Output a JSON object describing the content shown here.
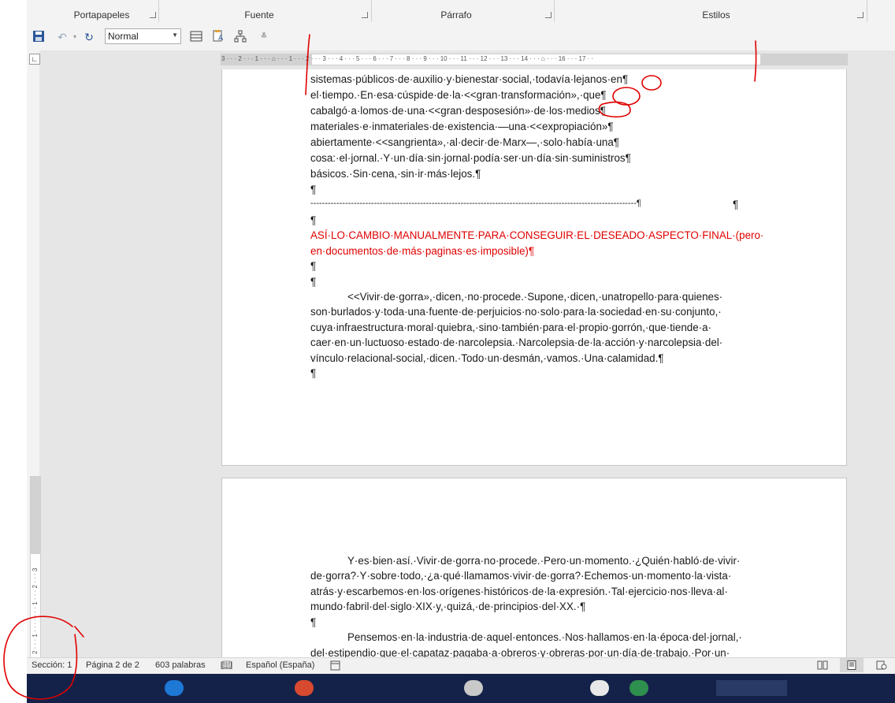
{
  "ribbon": {
    "groups": [
      "Portapapeles",
      "Fuente",
      "Párrafo",
      "Estilos"
    ]
  },
  "qat": {
    "style_value": "Normal",
    "icons": [
      "save-icon",
      "undo-icon",
      "redo-icon",
      "table-icon",
      "format-painter-icon",
      "org-chart-icon",
      "customize-icon"
    ]
  },
  "ruler": {
    "marks": "3 · · · 2 · · · 1 · · · ⌂ · · · 1 · · · 2 · · · 3 · · · 4 · · · 5 · · · 6 · · · 7 · · · 8 · · · 9 · · · 10 · · · 11 · · · 12 · · · 13 · · · 14 · · · ⌂ · · · 16 · · · 17 · ·",
    "vmarks": "2 · · · 1 · · · · · · · 1 · · · 2 · · · 3"
  },
  "page1": {
    "lines": [
      "sistemas·públicos·de·auxilio·y·bienestar·social,·todavía·lejanos·en¶",
      "el·tiempo.·En·esa·cúspide·de·la·<<gran·transformación»,·que¶",
      "cabalgó·a·lomos·de·una·<<gran·desposesión»·de·los·medios¶",
      "materiales·e·inmateriales·de·existencia·—una·<<expropiación»¶",
      "abiertamente·<<sangrienta»,·al·decir·de·Marx—,·solo·había·una¶",
      "cosa:·el·jornal.·Y·un·día·sin·jornal·podía·ser·un·día·sin·suministros¶",
      "básicos.·Sin·cena,·sin·ir·más·lejos.¶",
      "¶",
      "-----------------------------------------------------------------------------------------------------------------¶",
      "¶"
    ],
    "red_lines": [
      "ASÍ·LO·CAMBIO·MANUALMENTE·PARA·CONSEGUIR·EL·DESEADO·ASPECTO·FINAL·(pero·",
      "en·documentos·de·más·paginas·es·imposible)¶"
    ],
    "after_red": [
      "¶",
      "¶"
    ],
    "para": [
      "<<Vivir·de·gorra»,·dicen,·no·procede.·Supone,·dicen,·unatropello·para·quienes·",
      "son·burlados·y·toda·una·fuente·de·perjuicios·no·solo·para·la·sociedad·en·su·conjunto,·",
      "cuya·infraestructura·moral·quiebra,·sino·también·para·el·propio·gorrón,·que·tiende·a·",
      "caer·en·un·luctuoso·estado·de·narcolepsia.·Narcolepsia·de·la·acción·y·narcolepsia·del·",
      "vínculo·relacional-social,·dicen.·Todo·un·desmán,·vamos.·Una·calamidad.¶"
    ],
    "end": "¶"
  },
  "page2": {
    "para1": [
      "Y·es·bien·así.·Vivir·de·gorra·no·procede.·Pero·un·momento.·¿Quién·habló·de·vivir·",
      "de·gorra?·Y·sobre·todo,·¿a·qué·llamamos·vivir·de·gorra?·Echemos·un·momento·la·vista·",
      "atrás·y·escarbemos·en·los·orígenes·históricos·de·la·expresión.·Tal·ejercicio·nos·lleva·al·",
      "mundo·fabril·del·siglo·XIX·y,·quizá,·de·principios·del·XX.·¶"
    ],
    "blank": "¶",
    "para2": [
      "Pensemos·en·la·industria·de·aquel·entonces.·Nos·hallamos·en·la·época·del·jornal,·",
      "del·estipendio·que·el·capataz·pagaba·a·obreros·y·obreras·por·un·día·de·trabajo.·Por·un·"
    ]
  },
  "status": {
    "section": "Sección: 1",
    "page": "Página 2 de 2",
    "words": "603 palabras",
    "language": "Español (España)"
  },
  "colors": {
    "accent": "#2b579a",
    "annotation": "#e00000",
    "taskbar": "#14224a"
  }
}
